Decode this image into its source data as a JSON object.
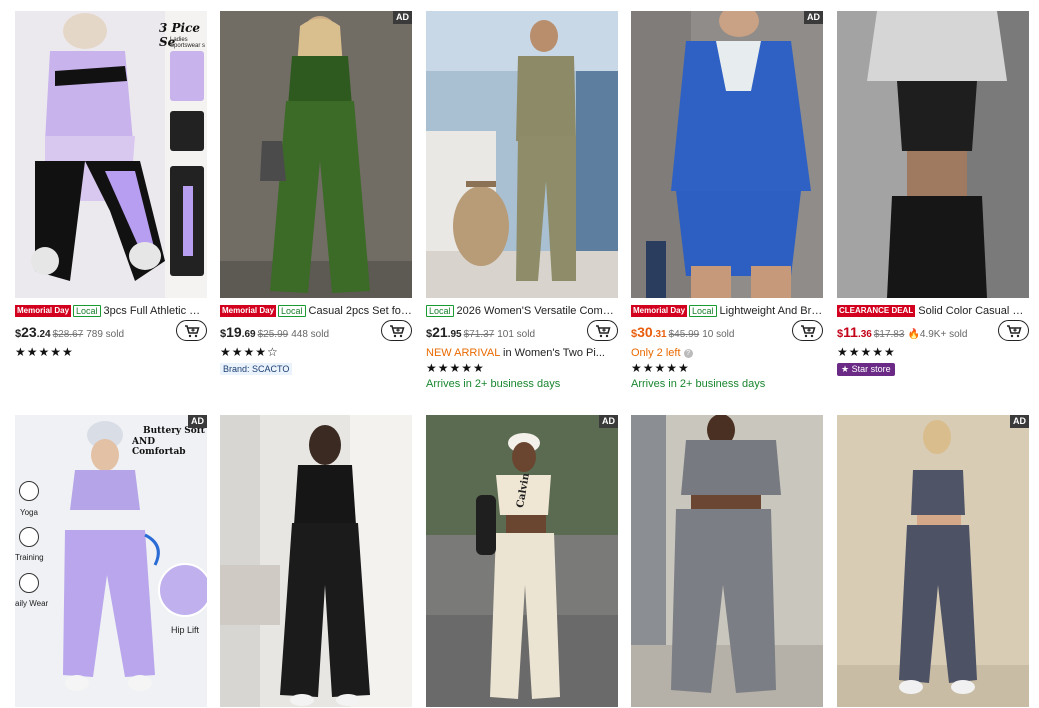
{
  "products": [
    {
      "title": "3pcs Full Athletic Out...",
      "memorial": "Memorial Day",
      "local": "Local",
      "price_dollar": "$",
      "price_int": "23",
      "price_cents": ".24",
      "orig": "$28.67",
      "sold": "789 sold",
      "stars": "★★★★★",
      "overlay": "3 Pice Se",
      "overlay_sub": "Ladies Sportswear s"
    },
    {
      "title": "Casual 2pcs Set for ...",
      "memorial": "Memorial Day",
      "local": "Local",
      "price_dollar": "$",
      "price_int": "19",
      "price_cents": ".69",
      "orig": "$25.99",
      "sold": "448 sold",
      "stars": "★★★★☆",
      "brand": "Brand: SCACTO",
      "ad": "AD"
    },
    {
      "title": "2026 Women'S Versatile Comm...",
      "local": "Local",
      "price_dollar": "$",
      "price_int": "21",
      "price_cents": ".95",
      "orig": "$71.37",
      "sold": "101 sold",
      "new_arrival": "NEW ARRIVAL",
      "new_arrival_rest": " in Women's Two Pi...",
      "stars": "★★★★★",
      "arrives": "Arrives in 2+ business days"
    },
    {
      "title": "Lightweight And Brea...",
      "memorial": "Memorial Day",
      "local": "Local",
      "price_dollar": "$",
      "price_int": "30",
      "price_cents": ".31",
      "orig": "$45.99",
      "sold": "10 sold",
      "only_left": "Only 2 left",
      "stars": "★★★★★",
      "arrives": "Arrives in 2+ business days",
      "ad": "AD"
    },
    {
      "title": "Solid Color Casual Wo...",
      "clearance": "CLEARANCE DEAL",
      "price_dollar": "$",
      "price_int": "11",
      "price_cents": ".36",
      "orig": "$17.83",
      "sold": "4.9K+ sold",
      "stars": "★★★★★",
      "star_store": "Star store"
    }
  ],
  "row2": [
    {
      "ad": "AD",
      "overlay1": "Buttery Soft",
      "overlay2": "AND Comfortab",
      "label_yoga": "Yoga",
      "label_training": "Training",
      "label_wear": "aily Wear",
      "label_hip": "Hip Lift"
    },
    {},
    {
      "ad": "AD",
      "shirt_text": "Calvin"
    },
    {},
    {
      "ad": "AD"
    }
  ],
  "colors": {
    "memorial_red": "#d2001e",
    "local_green": "#1a9b32",
    "sale_orange": "#e85d0c",
    "star_store_purple": "#6a2a85"
  }
}
